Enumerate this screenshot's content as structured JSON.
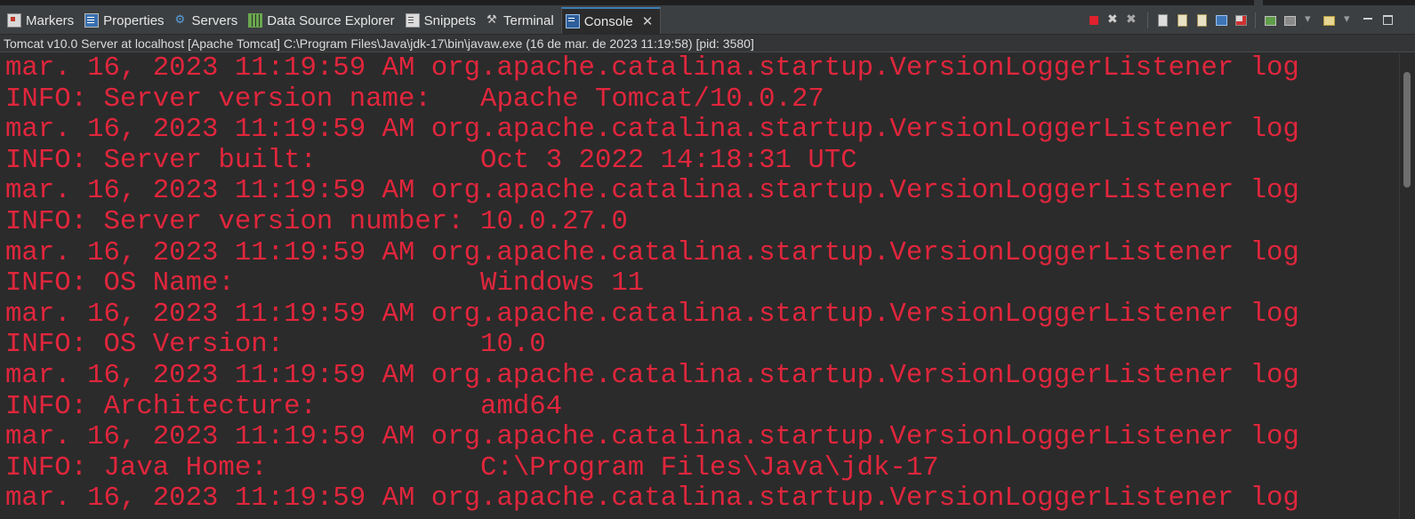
{
  "tabs": [
    {
      "label": "Markers",
      "icon": "markers-icon"
    },
    {
      "label": "Properties",
      "icon": "properties-icon"
    },
    {
      "label": "Servers",
      "icon": "servers-icon"
    },
    {
      "label": "Data Source Explorer",
      "icon": "data-source-explorer-icon"
    },
    {
      "label": "Snippets",
      "icon": "snippets-icon"
    },
    {
      "label": "Terminal",
      "icon": "terminal-icon"
    },
    {
      "label": "Console",
      "icon": "console-icon",
      "active": true,
      "close": "✕"
    }
  ],
  "toolbar": {
    "icons": [
      "terminate-icon",
      "remove-launch-icon",
      "remove-all-terminated-icon",
      "clear-console-icon",
      "scroll-lock-icon",
      "word-wrap-icon",
      "pin-console-icon",
      "show-console-on-output-icon",
      "display-selected-console-icon",
      "open-console-icon",
      "minimize-icon",
      "maximize-icon"
    ]
  },
  "info": {
    "text": "Tomcat v10.0 Server at localhost [Apache Tomcat] C:\\Program Files\\Java\\jdk-17\\bin\\javaw.exe  (16 de mar. de 2023 11:19:58) [pid: 3580]"
  },
  "console": {
    "text_color": "#e0263c",
    "lines": [
      "mar. 16, 2023 11:19:59 AM org.apache.catalina.startup.VersionLoggerListener log",
      "INFO: Server version name:   Apache Tomcat/10.0.27",
      "mar. 16, 2023 11:19:59 AM org.apache.catalina.startup.VersionLoggerListener log",
      "INFO: Server built:          Oct 3 2022 14:18:31 UTC",
      "mar. 16, 2023 11:19:59 AM org.apache.catalina.startup.VersionLoggerListener log",
      "INFO: Server version number: 10.0.27.0",
      "mar. 16, 2023 11:19:59 AM org.apache.catalina.startup.VersionLoggerListener log",
      "INFO: OS Name:               Windows 11",
      "mar. 16, 2023 11:19:59 AM org.apache.catalina.startup.VersionLoggerListener log",
      "INFO: OS Version:            10.0",
      "mar. 16, 2023 11:19:59 AM org.apache.catalina.startup.VersionLoggerListener log",
      "INFO: Architecture:          amd64",
      "mar. 16, 2023 11:19:59 AM org.apache.catalina.startup.VersionLoggerListener log",
      "INFO: Java Home:             C:\\Program Files\\Java\\jdk-17",
      "mar. 16, 2023 11:19:59 AM org.apache.catalina.startup.VersionLoggerListener log"
    ]
  }
}
